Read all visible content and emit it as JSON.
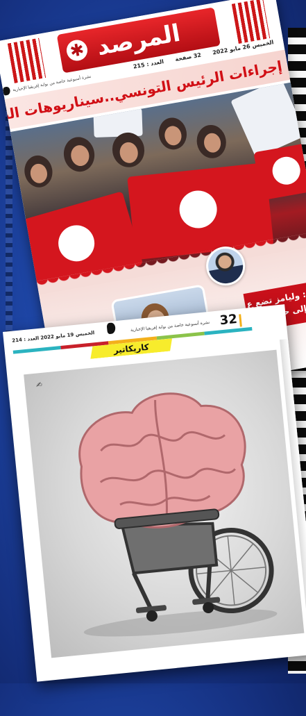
{
  "cover": {
    "masthead": "المرصد",
    "date": "الخميس 26 مايو 2022",
    "pages": "32 صفحة",
    "issue": "العدد : 215",
    "tagline": "نشرة أسبوعية خاصة من بوابة إفريقيا الإخبارية",
    "headline": "إجراءات الرئيس التونسي..سيناريوهات النجاح والفشل",
    "side_headline_line1": "يحي: وليامز تضع ع",
    "side_headline_line2": "ليبيا إلى حل"
  },
  "inside_page": {
    "page_number": "32",
    "title": "نشرة أسبوعية خاصة من بوابة إفريقيا الإخبارية",
    "date": "الخميس 19 مايو 2022 العدد : 214",
    "section": "كاريكاتير",
    "color_bar": [
      "#2bb3c0",
      "#c8202a",
      "#f3b01b",
      "#8bc34a",
      "#2bb3c0"
    ]
  },
  "colors": {
    "brand_red": "#cc1718",
    "background_blue": "#1e46a6",
    "banner_yellow": "#f7ec2c"
  }
}
